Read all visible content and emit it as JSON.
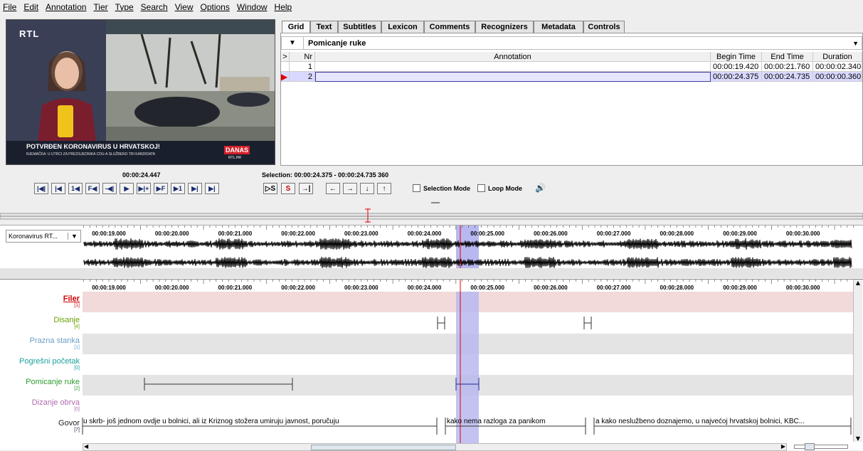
{
  "menu": [
    "File",
    "Edit",
    "Annotation",
    "Tier",
    "Type",
    "Search",
    "View",
    "Options",
    "Window",
    "Help"
  ],
  "video": {
    "logo": "RTL",
    "headline": "POTVRĐEN KORONAVIRUS U HRVATSKOJ!",
    "ticker": "NJEMAČKA: U UTRCI ZA PREDSJEDNIKA CDU-A SLUŽBENO TRI KANDIDATA",
    "badge": "DANAS",
    "badge_sub": "RTL.HR"
  },
  "tabs": [
    "Grid",
    "Text",
    "Subtitles",
    "Lexicon",
    "Comments",
    "Recognizers",
    "Metadata",
    "Controls"
  ],
  "grid": {
    "tier": "Pomicanje ruke",
    "headers": {
      "sel": ">",
      "nr": "Nr",
      "annotation": "Annotation",
      "begin": "Begin Time",
      "end": "End Time",
      "duration": "Duration"
    },
    "rows": [
      {
        "nr": "1",
        "annotation": "",
        "begin": "00:00:19.420",
        "end": "00:00:21.760",
        "duration": "00:00:02.340"
      },
      {
        "nr": "2",
        "annotation": "",
        "begin": "00:00:24.375",
        "end": "00:00:24.735",
        "duration": "00:00:00.360"
      }
    ]
  },
  "controls": {
    "current_time": "00:00:24.447",
    "selection": "Selection: 00:00:24.375 - 00:00:24.735  360",
    "selection_mode": "Selection Mode",
    "loop_mode": "Loop Mode",
    "play_buttons": [
      "|◀|",
      "|◀",
      "1◀",
      "F◀",
      "-◀|",
      "▶",
      "▶|+",
      "▶F",
      "▶1",
      "▶|",
      "▶|"
    ],
    "selection_buttons": [
      "▷S",
      "S",
      "→|"
    ],
    "nav_buttons": [
      "←",
      "→",
      "↓",
      "↑"
    ]
  },
  "wave": {
    "media": "Koronavirus RT..."
  },
  "timeline_ticks": [
    "00:00:19.000",
    "00:00:20.000",
    "00:00:21.000",
    "00:00:22.000",
    "00:00:23.000",
    "00:00:24.000",
    "00:00:25.000",
    "00:00:26.000",
    "00:00:27.000",
    "00:00:28.000",
    "00:00:29.000",
    "00:00:30.000"
  ],
  "tiers": [
    {
      "name": "Filer",
      "count": "[1]",
      "color": "#cc0000",
      "underline": true
    },
    {
      "name": "Disanje",
      "count": "[4]",
      "color": "#6aa000",
      "underline": false
    },
    {
      "name": "Prazna stanka",
      "count": "[1]",
      "color": "#6aa0c8",
      "underline": false
    },
    {
      "name": "Pogrešni početak",
      "count": "[0]",
      "color": "#1c9fa0",
      "underline": false
    },
    {
      "name": "Pomicanje ruke",
      "count": "[2]",
      "color": "#2d9c2d",
      "underline": false
    },
    {
      "name": "Dizanje obrva",
      "count": "[0]",
      "color": "#b06ab0",
      "underline": false
    },
    {
      "name": "Govor",
      "count": "[7]",
      "color": "#222244",
      "underline": false
    }
  ],
  "govor_annotations": [
    "u skrb- još jednom ovdje u bolnici, ali iz Kriznog stožera umiruju javnost, poručuju",
    "kako nema razloga za panikom",
    "a kako neslužbeno doznajemo, u najvećoj hrvatskoj bolnici, KBC..."
  ],
  "colors": {
    "selection": "#b8b8f0",
    "cursor": "#e00000",
    "filer_bg": "#f2dada",
    "tier_alt": "#e4e4e4",
    "grid_selected": "#d9d9ff"
  }
}
